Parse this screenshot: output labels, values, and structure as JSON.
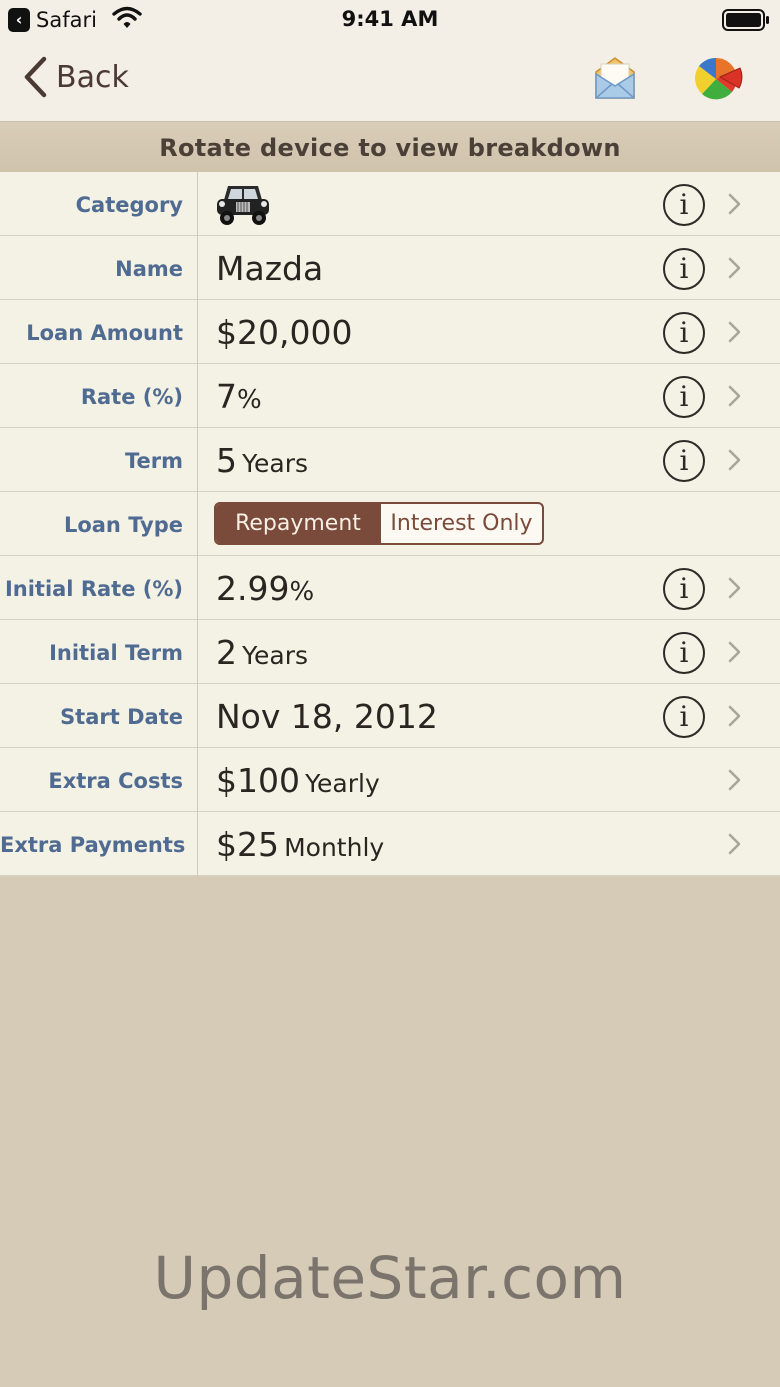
{
  "status_bar": {
    "back_app_label": "Safari",
    "time": "9:41 AM"
  },
  "nav": {
    "back_label": "Back",
    "mail_icon": "envelope-icon",
    "chart_icon": "pie-chart-icon"
  },
  "banner": {
    "text": "Rotate device to view breakdown"
  },
  "rows": {
    "category": {
      "label": "Category",
      "icon": "car-icon"
    },
    "name": {
      "label": "Name",
      "value": "Mazda"
    },
    "loan_amount": {
      "label": "Loan Amount",
      "value": "$20,000"
    },
    "rate": {
      "label": "Rate (%)",
      "value": "7",
      "unit": "%"
    },
    "term": {
      "label": "Term",
      "value": "5",
      "unit": "Years"
    },
    "loan_type": {
      "label": "Loan Type",
      "options": [
        "Repayment",
        "Interest Only"
      ],
      "selected": "Repayment"
    },
    "initial_rate": {
      "label": "Initial Rate (%)",
      "value": "2.99",
      "unit": "%"
    },
    "initial_term": {
      "label": "Initial Term",
      "value": "2",
      "unit": "Years"
    },
    "start_date": {
      "label": "Start Date",
      "value": "Nov 18, 2012"
    },
    "extra_costs": {
      "label": "Extra Costs",
      "value": "$100",
      "unit": "Yearly"
    },
    "extra_payments": {
      "label": "Extra Payments",
      "value": "$25",
      "unit": "Monthly"
    }
  },
  "info_glyph": "i",
  "watermark": "UpdateStar.com",
  "colors": {
    "label_blue": "#4f6b91",
    "accent_brown": "#7a4a3a",
    "table_bg": "#f4f1e5",
    "background": "#d6cbb7"
  }
}
